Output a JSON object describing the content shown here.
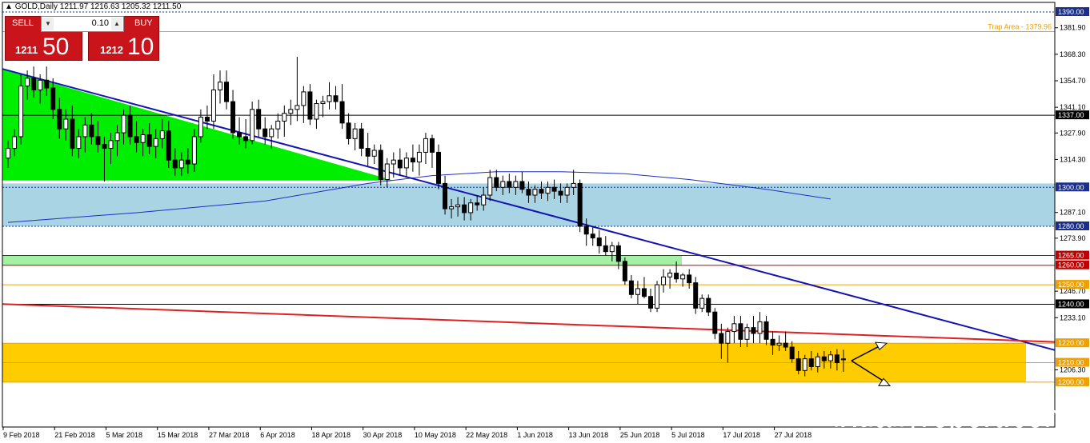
{
  "header": {
    "symbol_line": "GOLD,Daily  1211.97 1216.63 1205.32 1211.50"
  },
  "trade_panel": {
    "sell_label": "SELL",
    "buy_label": "BUY",
    "quantity": "0.10",
    "sell_price_small": "1211",
    "sell_price_big": "50",
    "buy_price_small": "1212",
    "buy_price_big": "10"
  },
  "watermark": "fxdailyreport.com",
  "chart_data": {
    "type": "candlestick",
    "symbol": "GOLD",
    "timeframe": "Daily",
    "ylim": [
      1196,
      1393
    ],
    "y_ticks": [
      "1381.90",
      "1368.30",
      "1354.70",
      "1341.10",
      "1327.90",
      "1314.30",
      "1287.10",
      "1273.90",
      "1246.70",
      "1233.10",
      "1206.30"
    ],
    "x_ticks": [
      "9 Feb 2018",
      "21 Feb 2018",
      "5 Mar 2018",
      "15 Mar 2018",
      "27 Mar 2018",
      "6 Apr 2018",
      "18 Apr 2018",
      "30 Apr 2018",
      "10 May 2018",
      "22 May 2018",
      "1 Jun 2018",
      "13 Jun 2018",
      "25 Jun 2018",
      "5 Jul 2018",
      "17 Jul 2018",
      "27 Jul 2018"
    ],
    "x_tick_index": [
      0,
      8,
      16,
      24,
      32,
      40,
      48,
      56,
      64,
      72,
      80,
      88,
      96,
      104,
      112,
      120
    ],
    "bar_count": 131,
    "price_levels": [
      {
        "label": "1390.00",
        "value": 1390,
        "color": "#1a2f8c",
        "style": "dotted"
      },
      {
        "label": "1337.00",
        "value": 1337,
        "color": "#000000",
        "style": "solid"
      },
      {
        "label": "1300.00",
        "value": 1300,
        "color": "#1a2f8c",
        "style": "dotted"
      },
      {
        "label": "1280.00",
        "value": 1280,
        "color": "#1a2f8c",
        "style": "dotted"
      },
      {
        "label": "1265.00",
        "value": 1265,
        "color": "#c00000",
        "style": "solid"
      },
      {
        "label": "1260.00",
        "value": 1260,
        "color": "#c00000",
        "style": "solid"
      },
      {
        "label": "1250.00",
        "value": 1250,
        "color": "#f0a000",
        "style": "solid"
      },
      {
        "label": "1240.00",
        "value": 1240,
        "color": "#000000",
        "style": "solid"
      },
      {
        "label": "1220.00",
        "value": 1220,
        "color": "#f0a000",
        "style": "solid"
      },
      {
        "label": "1210.00",
        "value": 1210,
        "color": "#f0a000",
        "style": "solid"
      },
      {
        "label": "1200.00",
        "value": 1200,
        "color": "#f0a000",
        "style": "solid"
      }
    ],
    "zones": [
      {
        "name": "blue-zone",
        "from": 1280,
        "to": 1302,
        "color": "#a9d4e4"
      },
      {
        "name": "green-band",
        "from": 1260,
        "to": 1265,
        "color": "#a4f0a4"
      },
      {
        "name": "yellow-zone",
        "from": 1200,
        "to": 1220,
        "color": "#ffcc00"
      }
    ],
    "annotation": {
      "text": "Trap Area - 1379.96",
      "value": 1379.96,
      "color": "#f0a000"
    },
    "candles": [
      {
        "o": 1315,
        "h": 1324,
        "l": 1310,
        "c": 1320
      },
      {
        "o": 1320,
        "h": 1330,
        "l": 1316,
        "c": 1326
      },
      {
        "o": 1326,
        "h": 1358,
        "l": 1322,
        "c": 1352
      },
      {
        "o": 1352,
        "h": 1360,
        "l": 1345,
        "c": 1356
      },
      {
        "o": 1356,
        "h": 1362,
        "l": 1346,
        "c": 1350
      },
      {
        "o": 1350,
        "h": 1358,
        "l": 1343,
        "c": 1355
      },
      {
        "o": 1355,
        "h": 1362,
        "l": 1347,
        "c": 1351
      },
      {
        "o": 1351,
        "h": 1356,
        "l": 1335,
        "c": 1340
      },
      {
        "o": 1340,
        "h": 1346,
        "l": 1325,
        "c": 1330
      },
      {
        "o": 1330,
        "h": 1340,
        "l": 1324,
        "c": 1335
      },
      {
        "o": 1335,
        "h": 1342,
        "l": 1316,
        "c": 1320
      },
      {
        "o": 1320,
        "h": 1330,
        "l": 1315,
        "c": 1326
      },
      {
        "o": 1326,
        "h": 1336,
        "l": 1318,
        "c": 1332
      },
      {
        "o": 1332,
        "h": 1338,
        "l": 1322,
        "c": 1326
      },
      {
        "o": 1326,
        "h": 1334,
        "l": 1318,
        "c": 1322
      },
      {
        "o": 1322,
        "h": 1326,
        "l": 1303,
        "c": 1320
      },
      {
        "o": 1320,
        "h": 1328,
        "l": 1312,
        "c": 1324
      },
      {
        "o": 1324,
        "h": 1332,
        "l": 1316,
        "c": 1328
      },
      {
        "o": 1328,
        "h": 1340,
        "l": 1322,
        "c": 1337
      },
      {
        "o": 1337,
        "h": 1342,
        "l": 1322,
        "c": 1326
      },
      {
        "o": 1326,
        "h": 1334,
        "l": 1318,
        "c": 1323
      },
      {
        "o": 1323,
        "h": 1330,
        "l": 1316,
        "c": 1327
      },
      {
        "o": 1327,
        "h": 1333,
        "l": 1317,
        "c": 1321
      },
      {
        "o": 1321,
        "h": 1330,
        "l": 1315,
        "c": 1325
      },
      {
        "o": 1325,
        "h": 1335,
        "l": 1320,
        "c": 1329
      },
      {
        "o": 1329,
        "h": 1334,
        "l": 1310,
        "c": 1314
      },
      {
        "o": 1314,
        "h": 1320,
        "l": 1306,
        "c": 1310
      },
      {
        "o": 1310,
        "h": 1318,
        "l": 1306,
        "c": 1314
      },
      {
        "o": 1314,
        "h": 1320,
        "l": 1307,
        "c": 1312
      },
      {
        "o": 1312,
        "h": 1330,
        "l": 1308,
        "c": 1326
      },
      {
        "o": 1326,
        "h": 1340,
        "l": 1323,
        "c": 1336
      },
      {
        "o": 1336,
        "h": 1342,
        "l": 1330,
        "c": 1334
      },
      {
        "o": 1334,
        "h": 1358,
        "l": 1330,
        "c": 1350
      },
      {
        "o": 1350,
        "h": 1360,
        "l": 1343,
        "c": 1354
      },
      {
        "o": 1354,
        "h": 1360,
        "l": 1340,
        "c": 1344
      },
      {
        "o": 1344,
        "h": 1350,
        "l": 1325,
        "c": 1328
      },
      {
        "o": 1328,
        "h": 1336,
        "l": 1322,
        "c": 1326
      },
      {
        "o": 1326,
        "h": 1335,
        "l": 1320,
        "c": 1324
      },
      {
        "o": 1324,
        "h": 1344,
        "l": 1322,
        "c": 1340
      },
      {
        "o": 1340,
        "h": 1345,
        "l": 1326,
        "c": 1330
      },
      {
        "o": 1330,
        "h": 1336,
        "l": 1322,
        "c": 1326
      },
      {
        "o": 1326,
        "h": 1332,
        "l": 1320,
        "c": 1330
      },
      {
        "o": 1330,
        "h": 1338,
        "l": 1325,
        "c": 1334
      },
      {
        "o": 1334,
        "h": 1342,
        "l": 1326,
        "c": 1338
      },
      {
        "o": 1338,
        "h": 1345,
        "l": 1332,
        "c": 1340
      },
      {
        "o": 1340,
        "h": 1367,
        "l": 1334,
        "c": 1342
      },
      {
        "o": 1342,
        "h": 1352,
        "l": 1333,
        "c": 1349
      },
      {
        "o": 1349,
        "h": 1353,
        "l": 1332,
        "c": 1335
      },
      {
        "o": 1335,
        "h": 1345,
        "l": 1330,
        "c": 1343
      },
      {
        "o": 1343,
        "h": 1347,
        "l": 1336,
        "c": 1344
      },
      {
        "o": 1344,
        "h": 1354,
        "l": 1340,
        "c": 1347
      },
      {
        "o": 1347,
        "h": 1352,
        "l": 1340,
        "c": 1344
      },
      {
        "o": 1344,
        "h": 1353,
        "l": 1330,
        "c": 1333
      },
      {
        "o": 1333,
        "h": 1338,
        "l": 1322,
        "c": 1325
      },
      {
        "o": 1325,
        "h": 1333,
        "l": 1319,
        "c": 1330
      },
      {
        "o": 1330,
        "h": 1333,
        "l": 1316,
        "c": 1320
      },
      {
        "o": 1320,
        "h": 1328,
        "l": 1311,
        "c": 1316
      },
      {
        "o": 1316,
        "h": 1322,
        "l": 1312,
        "c": 1319
      },
      {
        "o": 1319,
        "h": 1322,
        "l": 1301,
        "c": 1304
      },
      {
        "o": 1304,
        "h": 1315,
        "l": 1300,
        "c": 1312
      },
      {
        "o": 1312,
        "h": 1318,
        "l": 1305,
        "c": 1314
      },
      {
        "o": 1314,
        "h": 1320,
        "l": 1306,
        "c": 1310
      },
      {
        "o": 1310,
        "h": 1318,
        "l": 1305,
        "c": 1315
      },
      {
        "o": 1315,
        "h": 1322,
        "l": 1308,
        "c": 1313
      },
      {
        "o": 1313,
        "h": 1322,
        "l": 1306,
        "c": 1318
      },
      {
        "o": 1318,
        "h": 1328,
        "l": 1312,
        "c": 1325
      },
      {
        "o": 1325,
        "h": 1327,
        "l": 1310,
        "c": 1318
      },
      {
        "o": 1318,
        "h": 1322,
        "l": 1299,
        "c": 1302
      },
      {
        "o": 1302,
        "h": 1306,
        "l": 1286,
        "c": 1289
      },
      {
        "o": 1289,
        "h": 1294,
        "l": 1284,
        "c": 1290
      },
      {
        "o": 1290,
        "h": 1295,
        "l": 1285,
        "c": 1291
      },
      {
        "o": 1291,
        "h": 1295,
        "l": 1283,
        "c": 1287
      },
      {
        "o": 1287,
        "h": 1294,
        "l": 1283,
        "c": 1292
      },
      {
        "o": 1292,
        "h": 1296,
        "l": 1288,
        "c": 1291
      },
      {
        "o": 1291,
        "h": 1300,
        "l": 1288,
        "c": 1296
      },
      {
        "o": 1296,
        "h": 1309,
        "l": 1293,
        "c": 1305
      },
      {
        "o": 1305,
        "h": 1309,
        "l": 1298,
        "c": 1300
      },
      {
        "o": 1300,
        "h": 1306,
        "l": 1296,
        "c": 1303
      },
      {
        "o": 1303,
        "h": 1307,
        "l": 1297,
        "c": 1300
      },
      {
        "o": 1300,
        "h": 1306,
        "l": 1296,
        "c": 1303
      },
      {
        "o": 1303,
        "h": 1308,
        "l": 1297,
        "c": 1299
      },
      {
        "o": 1299,
        "h": 1303,
        "l": 1292,
        "c": 1296
      },
      {
        "o": 1296,
        "h": 1301,
        "l": 1292,
        "c": 1299
      },
      {
        "o": 1299,
        "h": 1303,
        "l": 1294,
        "c": 1297
      },
      {
        "o": 1297,
        "h": 1303,
        "l": 1293,
        "c": 1300
      },
      {
        "o": 1300,
        "h": 1304,
        "l": 1294,
        "c": 1298
      },
      {
        "o": 1298,
        "h": 1302,
        "l": 1292,
        "c": 1296
      },
      {
        "o": 1296,
        "h": 1302,
        "l": 1292,
        "c": 1300
      },
      {
        "o": 1300,
        "h": 1309,
        "l": 1296,
        "c": 1302
      },
      {
        "o": 1302,
        "h": 1304,
        "l": 1277,
        "c": 1280
      },
      {
        "o": 1280,
        "h": 1284,
        "l": 1270,
        "c": 1276
      },
      {
        "o": 1276,
        "h": 1280,
        "l": 1270,
        "c": 1274
      },
      {
        "o": 1274,
        "h": 1278,
        "l": 1266,
        "c": 1270
      },
      {
        "o": 1270,
        "h": 1275,
        "l": 1265,
        "c": 1267
      },
      {
        "o": 1267,
        "h": 1272,
        "l": 1262,
        "c": 1270
      },
      {
        "o": 1270,
        "h": 1272,
        "l": 1258,
        "c": 1262
      },
      {
        "o": 1262,
        "h": 1264,
        "l": 1250,
        "c": 1252
      },
      {
        "o": 1252,
        "h": 1255,
        "l": 1243,
        "c": 1245
      },
      {
        "o": 1245,
        "h": 1252,
        "l": 1240,
        "c": 1248
      },
      {
        "o": 1248,
        "h": 1254,
        "l": 1243,
        "c": 1244
      },
      {
        "o": 1244,
        "h": 1248,
        "l": 1236,
        "c": 1238
      },
      {
        "o": 1238,
        "h": 1252,
        "l": 1236,
        "c": 1250
      },
      {
        "o": 1250,
        "h": 1258,
        "l": 1246,
        "c": 1254
      },
      {
        "o": 1254,
        "h": 1258,
        "l": 1248,
        "c": 1256
      },
      {
        "o": 1256,
        "h": 1262,
        "l": 1251,
        "c": 1253
      },
      {
        "o": 1253,
        "h": 1256,
        "l": 1249,
        "c": 1255
      },
      {
        "o": 1255,
        "h": 1258,
        "l": 1248,
        "c": 1251
      },
      {
        "o": 1251,
        "h": 1254,
        "l": 1235,
        "c": 1238
      },
      {
        "o": 1238,
        "h": 1245,
        "l": 1236,
        "c": 1243
      },
      {
        "o": 1243,
        "h": 1245,
        "l": 1234,
        "c": 1236
      },
      {
        "o": 1236,
        "h": 1238,
        "l": 1222,
        "c": 1225
      },
      {
        "o": 1225,
        "h": 1230,
        "l": 1212,
        "c": 1220
      },
      {
        "o": 1220,
        "h": 1228,
        "l": 1210,
        "c": 1226
      },
      {
        "o": 1226,
        "h": 1234,
        "l": 1220,
        "c": 1230
      },
      {
        "o": 1230,
        "h": 1234,
        "l": 1218,
        "c": 1222
      },
      {
        "o": 1222,
        "h": 1230,
        "l": 1218,
        "c": 1228
      },
      {
        "o": 1228,
        "h": 1234,
        "l": 1220,
        "c": 1225
      },
      {
        "o": 1225,
        "h": 1236,
        "l": 1220,
        "c": 1231
      },
      {
        "o": 1231,
        "h": 1234,
        "l": 1219,
        "c": 1222
      },
      {
        "o": 1222,
        "h": 1226,
        "l": 1214,
        "c": 1219
      },
      {
        "o": 1219,
        "h": 1224,
        "l": 1216,
        "c": 1220
      },
      {
        "o": 1220,
        "h": 1226,
        "l": 1216,
        "c": 1218
      },
      {
        "o": 1218,
        "h": 1221,
        "l": 1210,
        "c": 1212
      },
      {
        "o": 1212,
        "h": 1216,
        "l": 1204,
        "c": 1206
      },
      {
        "o": 1206,
        "h": 1214,
        "l": 1203,
        "c": 1212
      },
      {
        "o": 1212,
        "h": 1216,
        "l": 1206,
        "c": 1208
      },
      {
        "o": 1208,
        "h": 1215,
        "l": 1205,
        "c": 1213
      },
      {
        "o": 1213,
        "h": 1216,
        "l": 1207,
        "c": 1211
      },
      {
        "o": 1211,
        "h": 1216,
        "l": 1207,
        "c": 1214
      },
      {
        "o": 1214,
        "h": 1217,
        "l": 1206,
        "c": 1210
      },
      {
        "o": 1211.97,
        "h": 1216.63,
        "l": 1205.32,
        "c": 1211.5
      }
    ],
    "moving_average": [
      {
        "i": 0,
        "v": 1282
      },
      {
        "i": 20,
        "v": 1287
      },
      {
        "i": 40,
        "v": 1293
      },
      {
        "i": 56,
        "v": 1302
      },
      {
        "i": 66,
        "v": 1306
      },
      {
        "i": 76,
        "v": 1308
      },
      {
        "i": 86,
        "v": 1308
      },
      {
        "i": 96,
        "v": 1307
      },
      {
        "i": 106,
        "v": 1304
      },
      {
        "i": 118,
        "v": 1299
      },
      {
        "i": 128,
        "v": 1294
      }
    ],
    "trendlines": [
      {
        "name": "blue-downtrend",
        "color": "#1414b4",
        "from": {
          "i": 0,
          "v": 1360
        },
        "to": {
          "i": 160,
          "v": 1219
        }
      },
      {
        "name": "red-trend",
        "color": "#e02020",
        "from": {
          "i": 0,
          "v": 1240
        },
        "to": {
          "i": 160,
          "v": 1221
        }
      }
    ]
  }
}
